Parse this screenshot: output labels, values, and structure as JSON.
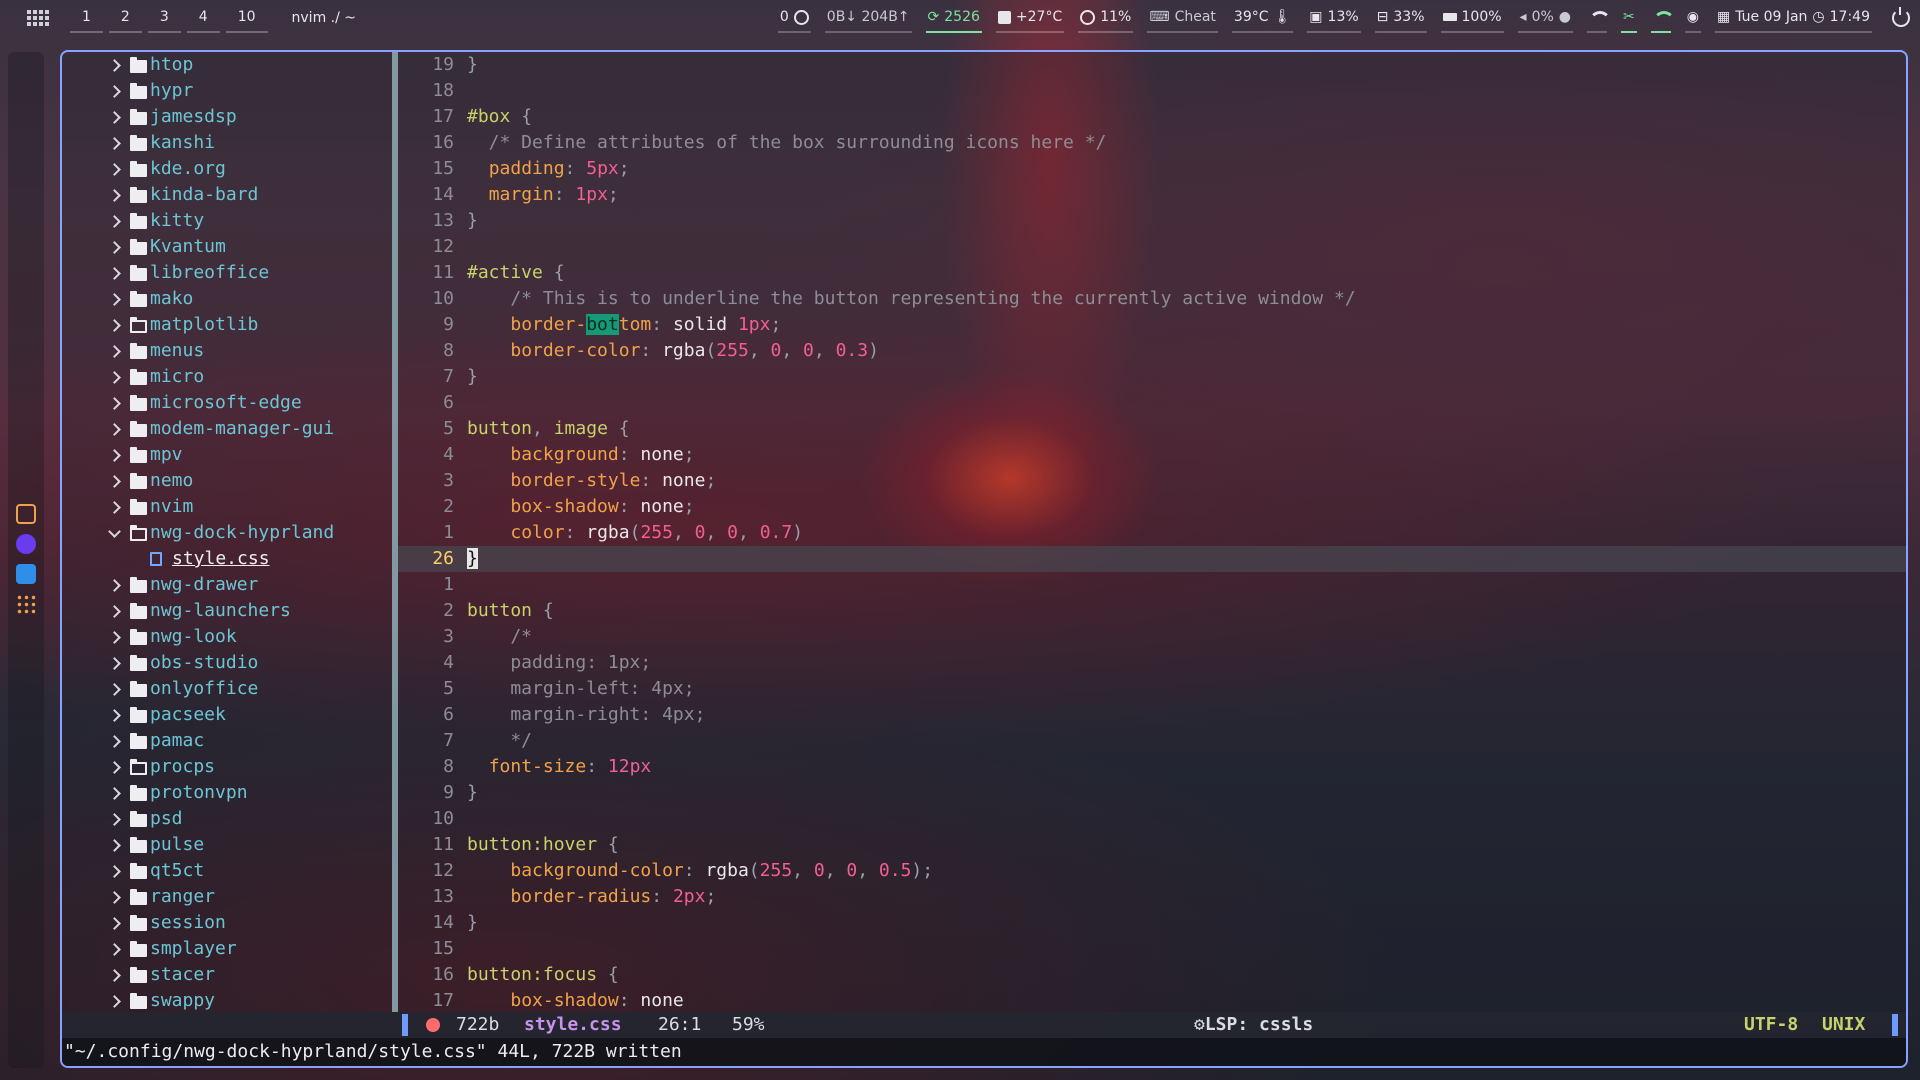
{
  "topbar": {
    "workspaces": [
      "1",
      "2",
      "3",
      "4",
      "10"
    ],
    "window_title": "nvim ./ ~",
    "modules": {
      "notifications": "0",
      "network": "0B↓ 204B↑",
      "updates": "2526",
      "weather": "+27°C",
      "cpu": "11%",
      "cheat": "Cheat",
      "temperature": "39°C",
      "memory": "13%",
      "disk": "33%",
      "battery": "100%",
      "volume": "0%",
      "date": "Tue 09 Jan",
      "time": "17:49"
    }
  },
  "file_tree": {
    "items": [
      {
        "label": "htop",
        "type": "folder"
      },
      {
        "label": "hypr",
        "type": "folder"
      },
      {
        "label": "jamesdsp",
        "type": "folder"
      },
      {
        "label": "kanshi",
        "type": "folder"
      },
      {
        "label": "kde.org",
        "type": "folder"
      },
      {
        "label": "kinda-bard",
        "type": "folder"
      },
      {
        "label": "kitty",
        "type": "folder"
      },
      {
        "label": "Kvantum",
        "type": "folder"
      },
      {
        "label": "libreoffice",
        "type": "folder"
      },
      {
        "label": "mako",
        "type": "folder"
      },
      {
        "label": "matplotlib",
        "type": "folder-empty"
      },
      {
        "label": "menus",
        "type": "folder"
      },
      {
        "label": "micro",
        "type": "folder"
      },
      {
        "label": "microsoft-edge",
        "type": "folder"
      },
      {
        "label": "modem-manager-gui",
        "type": "folder"
      },
      {
        "label": "mpv",
        "type": "folder"
      },
      {
        "label": "nemo",
        "type": "folder"
      },
      {
        "label": "nvim",
        "type": "folder"
      },
      {
        "label": "nwg-dock-hyprland",
        "type": "folder-open"
      },
      {
        "label": "style.css",
        "type": "file"
      },
      {
        "label": "nwg-drawer",
        "type": "folder"
      },
      {
        "label": "nwg-launchers",
        "type": "folder"
      },
      {
        "label": "nwg-look",
        "type": "folder"
      },
      {
        "label": "obs-studio",
        "type": "folder"
      },
      {
        "label": "onlyoffice",
        "type": "folder"
      },
      {
        "label": "pacseek",
        "type": "folder"
      },
      {
        "label": "pamac",
        "type": "folder"
      },
      {
        "label": "procps",
        "type": "folder-empty"
      },
      {
        "label": "protonvpn",
        "type": "folder"
      },
      {
        "label": "psd",
        "type": "folder"
      },
      {
        "label": "pulse",
        "type": "folder"
      },
      {
        "label": "qt5ct",
        "type": "folder"
      },
      {
        "label": "ranger",
        "type": "folder"
      },
      {
        "label": "session",
        "type": "folder"
      },
      {
        "label": "smplayer",
        "type": "folder"
      },
      {
        "label": "stacer",
        "type": "folder"
      },
      {
        "label": "swappy",
        "type": "folder"
      }
    ]
  },
  "editor": {
    "lines": [
      {
        "num": "19",
        "tokens": [
          [
            "}",
            "punct"
          ]
        ]
      },
      {
        "num": "18",
        "tokens": []
      },
      {
        "num": "17",
        "tokens": [
          [
            "#box",
            "sel"
          ],
          [
            " {",
            "punct"
          ]
        ]
      },
      {
        "num": "16",
        "tokens": [
          [
            "  /* Define attributes of the box surrounding icons here */",
            "com"
          ]
        ]
      },
      {
        "num": "15",
        "tokens": [
          [
            "  ",
            ""
          ],
          [
            "padding",
            "prop"
          ],
          [
            ": ",
            "punct"
          ],
          [
            "5px",
            "num"
          ],
          [
            ";",
            "punct"
          ]
        ]
      },
      {
        "num": "14",
        "tokens": [
          [
            "  ",
            ""
          ],
          [
            "margin",
            "prop"
          ],
          [
            ": ",
            "punct"
          ],
          [
            "1px",
            "num"
          ],
          [
            ";",
            "punct"
          ]
        ]
      },
      {
        "num": "13",
        "tokens": [
          [
            "}",
            "punct"
          ]
        ]
      },
      {
        "num": "12",
        "tokens": []
      },
      {
        "num": "11",
        "tokens": [
          [
            "#active",
            "sel"
          ],
          [
            " {",
            "punct"
          ]
        ]
      },
      {
        "num": "10",
        "tokens": [
          [
            "    /* This is to underline the button representing the currently active window */",
            "com"
          ]
        ]
      },
      {
        "num": "9",
        "tokens": [
          [
            "    ",
            ""
          ],
          [
            "border-",
            "prop"
          ],
          [
            "bot",
            "match"
          ],
          [
            "tom",
            "prop"
          ],
          [
            ": ",
            "punct"
          ],
          [
            "solid ",
            "kw"
          ],
          [
            "1px",
            "num"
          ],
          [
            ";",
            "punct"
          ]
        ]
      },
      {
        "num": "8",
        "tokens": [
          [
            "    ",
            ""
          ],
          [
            "border-color",
            "prop"
          ],
          [
            ": ",
            "punct"
          ],
          [
            "rgba",
            "kw"
          ],
          [
            "(",
            "punct"
          ],
          [
            "255",
            "num"
          ],
          [
            ", ",
            "punct"
          ],
          [
            "0",
            "num"
          ],
          [
            ", ",
            "punct"
          ],
          [
            "0",
            "num"
          ],
          [
            ", ",
            "punct"
          ],
          [
            "0.3",
            "num"
          ],
          [
            ")",
            "punct"
          ]
        ]
      },
      {
        "num": "7",
        "tokens": [
          [
            "}",
            "punct"
          ]
        ]
      },
      {
        "num": "6",
        "tokens": []
      },
      {
        "num": "5",
        "tokens": [
          [
            "button",
            "sel"
          ],
          [
            ", ",
            "punct"
          ],
          [
            "image",
            "sel"
          ],
          [
            " {",
            "punct"
          ]
        ]
      },
      {
        "num": "4",
        "tokens": [
          [
            "    ",
            ""
          ],
          [
            "background",
            "prop"
          ],
          [
            ": ",
            "punct"
          ],
          [
            "none",
            "kw"
          ],
          [
            ";",
            "punct"
          ]
        ]
      },
      {
        "num": "3",
        "tokens": [
          [
            "    ",
            ""
          ],
          [
            "border-style",
            "prop"
          ],
          [
            ": ",
            "punct"
          ],
          [
            "none",
            "kw"
          ],
          [
            ";",
            "punct"
          ]
        ]
      },
      {
        "num": "2",
        "tokens": [
          [
            "    ",
            ""
          ],
          [
            "box-shadow",
            "prop"
          ],
          [
            ": ",
            "punct"
          ],
          [
            "none",
            "kw"
          ],
          [
            ";",
            "punct"
          ]
        ]
      },
      {
        "num": "1",
        "tokens": [
          [
            "    ",
            ""
          ],
          [
            "color",
            "prop"
          ],
          [
            ": ",
            "punct"
          ],
          [
            "rgba",
            "kw"
          ],
          [
            "(",
            "punct"
          ],
          [
            "255",
            "num"
          ],
          [
            ", ",
            "punct"
          ],
          [
            "0",
            "num"
          ],
          [
            ", ",
            "punct"
          ],
          [
            "0",
            "num"
          ],
          [
            ", ",
            "punct"
          ],
          [
            "0.7",
            "num"
          ],
          [
            ")",
            "punct"
          ]
        ]
      },
      {
        "num": "26",
        "tokens": [
          [
            "}",
            "cursor"
          ]
        ],
        "current": true
      },
      {
        "num": "1",
        "tokens": []
      },
      {
        "num": "2",
        "tokens": [
          [
            "button",
            "sel"
          ],
          [
            " {",
            "punct"
          ]
        ]
      },
      {
        "num": "3",
        "tokens": [
          [
            "    /*",
            "com"
          ]
        ]
      },
      {
        "num": "4",
        "tokens": [
          [
            "    padding: 1px;",
            "com"
          ]
        ]
      },
      {
        "num": "5",
        "tokens": [
          [
            "    margin-left: 4px;",
            "com"
          ]
        ]
      },
      {
        "num": "6",
        "tokens": [
          [
            "    margin-right: 4px;",
            "com"
          ]
        ]
      },
      {
        "num": "7",
        "tokens": [
          [
            "    */",
            "com"
          ]
        ]
      },
      {
        "num": "8",
        "tokens": [
          [
            "  ",
            ""
          ],
          [
            "font-size",
            "prop"
          ],
          [
            ": ",
            "punct"
          ],
          [
            "12px",
            "num"
          ]
        ]
      },
      {
        "num": "9",
        "tokens": [
          [
            "}",
            "punct"
          ]
        ]
      },
      {
        "num": "10",
        "tokens": []
      },
      {
        "num": "11",
        "tokens": [
          [
            "button",
            "sel"
          ],
          [
            ":hover",
            "sel"
          ],
          [
            " {",
            "punct"
          ]
        ]
      },
      {
        "num": "12",
        "tokens": [
          [
            "    ",
            ""
          ],
          [
            "background-color",
            "prop"
          ],
          [
            ": ",
            "punct"
          ],
          [
            "rgba",
            "kw"
          ],
          [
            "(",
            "punct"
          ],
          [
            "255",
            "num"
          ],
          [
            ", ",
            "punct"
          ],
          [
            "0",
            "num"
          ],
          [
            ", ",
            "punct"
          ],
          [
            "0",
            "num"
          ],
          [
            ", ",
            "punct"
          ],
          [
            "0.5",
            "num"
          ],
          [
            ");",
            "punct"
          ]
        ]
      },
      {
        "num": "13",
        "tokens": [
          [
            "    ",
            ""
          ],
          [
            "border-radius",
            "prop"
          ],
          [
            ": ",
            "punct"
          ],
          [
            "2px",
            "num"
          ],
          [
            ";",
            "punct"
          ]
        ]
      },
      {
        "num": "14",
        "tokens": [
          [
            "}",
            "punct"
          ]
        ]
      },
      {
        "num": "15",
        "tokens": []
      },
      {
        "num": "16",
        "tokens": [
          [
            "button",
            "sel"
          ],
          [
            ":focus",
            "sel"
          ],
          [
            " {",
            "punct"
          ]
        ]
      },
      {
        "num": "17",
        "tokens": [
          [
            "    ",
            ""
          ],
          [
            "box-shadow",
            "prop"
          ],
          [
            ": ",
            "punct"
          ],
          [
            "none",
            "kw"
          ]
        ]
      }
    ]
  },
  "statusline": {
    "size": "722b",
    "filename": "style.css",
    "position": "26:1",
    "percent": "59%",
    "lsp": "LSP: cssls",
    "encoding": "UTF-8",
    "format": "UNIX"
  },
  "cmdline": "\"~/.config/nwg-dock-hyprland/style.css\" 44L, 722B written",
  "colors": {
    "border": "#8aa2ff",
    "tree_folder": "#6cc5d4",
    "status_name": "#c792ea",
    "status_right": "#c7d26b"
  }
}
